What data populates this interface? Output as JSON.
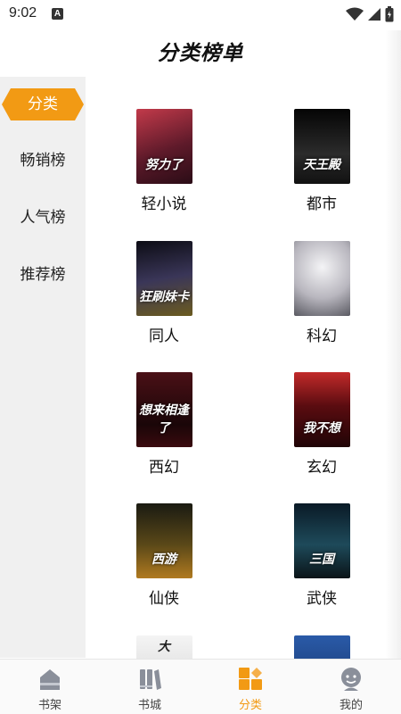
{
  "status_bar": {
    "time": "9:02",
    "badge": "A"
  },
  "header": {
    "title": "分类榜单"
  },
  "sidebar": {
    "items": [
      {
        "label": "分类",
        "active": true
      },
      {
        "label": "畅销榜",
        "active": false
      },
      {
        "label": "人气榜",
        "active": false
      },
      {
        "label": "推荐榜",
        "active": false
      }
    ]
  },
  "categories": [
    {
      "label": "轻小说",
      "cover_text": "努力了",
      "cover_color": "#7a1a24"
    },
    {
      "label": "都市",
      "cover_text": "天王殿",
      "cover_color": "#151515"
    },
    {
      "label": "同人",
      "cover_text": "狂刷妹卡",
      "cover_color": "#1d1b2e"
    },
    {
      "label": "科幻",
      "cover_text": "",
      "cover_color": "#d8d6dc"
    },
    {
      "label": "西幻",
      "cover_text": "想来相逢了",
      "cover_color": "#3a0e12"
    },
    {
      "label": "玄幻",
      "cover_text": "我不想",
      "cover_color": "#4a0d10"
    },
    {
      "label": "仙侠",
      "cover_text": "西游",
      "cover_color": "#2a2410"
    },
    {
      "label": "武侠",
      "cover_text": "三国",
      "cover_color": "#10202c"
    },
    {
      "label": "",
      "cover_text": "大",
      "cover_color": "#e8e8e8"
    },
    {
      "label": "",
      "cover_text": "",
      "cover_color": "#1b3a6b"
    }
  ],
  "bottom_nav": {
    "items": [
      {
        "label": "书架",
        "active": false,
        "icon": "bookshelf-icon"
      },
      {
        "label": "书城",
        "active": false,
        "icon": "bookstore-icon"
      },
      {
        "label": "分类",
        "active": true,
        "icon": "category-icon"
      },
      {
        "label": "我的",
        "active": false,
        "icon": "profile-icon"
      }
    ]
  },
  "colors": {
    "accent": "#f29a14",
    "sidebar_bg": "#f0f0f0",
    "inactive_icon": "#8a8f9a"
  }
}
